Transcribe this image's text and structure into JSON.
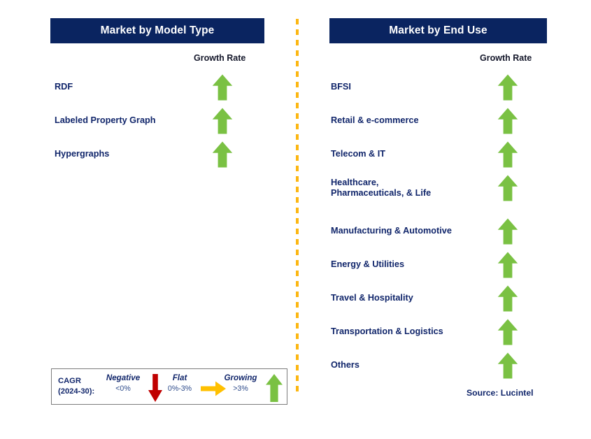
{
  "colors": {
    "header_bg": "#0a2460",
    "header_text": "#ffffff",
    "label_text": "#11266b",
    "arrow_growing": "#7ac143",
    "arrow_negative": "#c00000",
    "arrow_flat": "#ffc000",
    "divider": "#fcb713",
    "legend_border": "#7c7c7c"
  },
  "left_panel": {
    "title": "Market by Model Type",
    "growth_rate_label": "Growth Rate",
    "rows": [
      {
        "label": "RDF",
        "growth": "growing",
        "arrow_icon": "up-arrow-icon"
      },
      {
        "label": "Labeled Property Graph",
        "growth": "growing",
        "arrow_icon": "up-arrow-icon"
      },
      {
        "label": "Hypergraphs",
        "growth": "growing",
        "arrow_icon": "up-arrow-icon"
      }
    ]
  },
  "right_panel": {
    "title": "Market by End Use",
    "growth_rate_label": "Growth Rate",
    "rows": [
      {
        "label": "BFSI",
        "growth": "growing",
        "arrow_icon": "up-arrow-icon"
      },
      {
        "label": "Retail & e-commerce",
        "growth": "growing",
        "arrow_icon": "up-arrow-icon"
      },
      {
        "label": "Telecom & IT",
        "growth": "growing",
        "arrow_icon": "up-arrow-icon"
      },
      {
        "label": "Healthcare,\nPharmaceuticals, & Life",
        "growth": "growing",
        "arrow_icon": "up-arrow-icon"
      },
      {
        "label": "Manufacturing & Automotive",
        "growth": "growing",
        "arrow_icon": "up-arrow-icon"
      },
      {
        "label": "Energy & Utilities",
        "growth": "growing",
        "arrow_icon": "up-arrow-icon"
      },
      {
        "label": "Travel & Hospitality",
        "growth": "growing",
        "arrow_icon": "up-arrow-icon"
      },
      {
        "label": "Transportation & Logistics",
        "growth": "growing",
        "arrow_icon": "up-arrow-icon"
      },
      {
        "label": "Others",
        "growth": "growing",
        "arrow_icon": "up-arrow-icon"
      }
    ]
  },
  "legend": {
    "cagr_label": "CAGR\n(2024-30):",
    "items": [
      {
        "title": "Negative",
        "range": "<0%",
        "icon": "down-arrow-icon"
      },
      {
        "title": "Flat",
        "range": "0%-3%",
        "icon": "right-arrow-icon"
      },
      {
        "title": "Growing",
        "range": ">3%",
        "icon": "up-arrow-icon"
      }
    ]
  },
  "source": "Source: Lucintel"
}
